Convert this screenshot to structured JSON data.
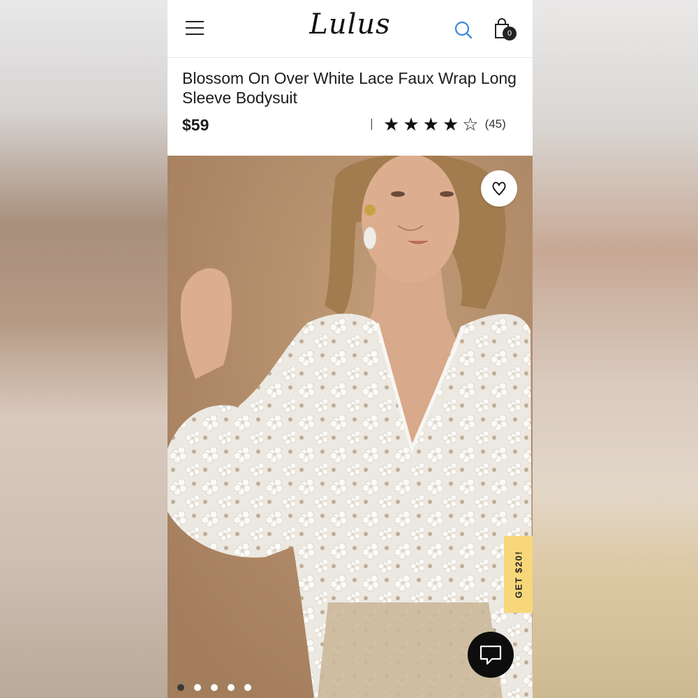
{
  "header": {
    "logo_text": "Lulus",
    "menu_icon": "hamburger-menu-icon",
    "search_icon": "search-icon",
    "bag_icon": "shopping-bag-icon",
    "bag_count": "0",
    "accent_color": "#3b87d6"
  },
  "product": {
    "title": "Blossom On Over White Lace Faux Wrap Long Sleeve Bodysuit",
    "price": "$59",
    "rating": 4,
    "rating_max": 5,
    "review_count": "(45)"
  },
  "gallery": {
    "favorite_icon": "heart-icon",
    "promo_label": "GET $20!",
    "promo_color": "#f7d77a",
    "chat_icon": "chat-bubble-icon",
    "dots": [
      true,
      false,
      false,
      false,
      false
    ]
  }
}
